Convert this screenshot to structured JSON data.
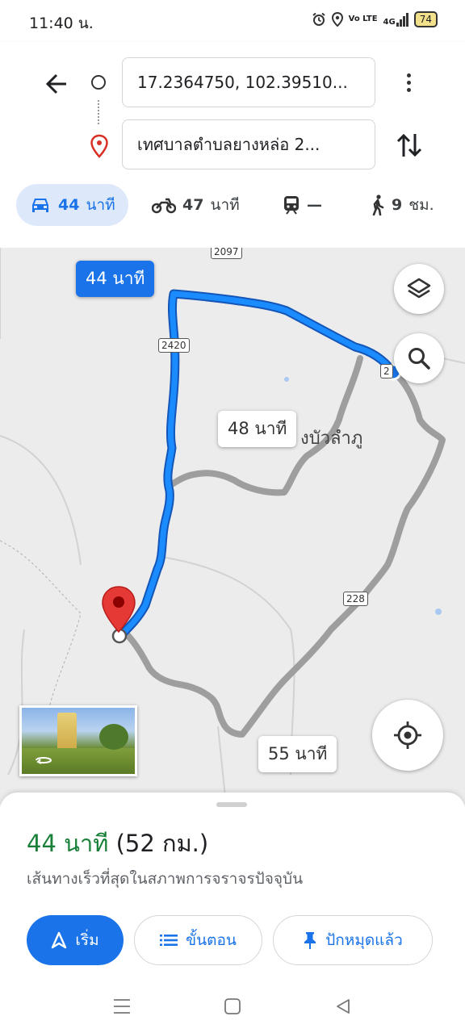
{
  "status": {
    "time": "11:40 น.",
    "volte": "Vo LTE",
    "network": "4G",
    "battery": "74"
  },
  "directions": {
    "origin": "17.2364750, 102.39510...",
    "destination": "เทศบาลตำบลยางหล่อ 2..."
  },
  "modes": [
    {
      "id": "drive",
      "time": "44",
      "unit": "นาที",
      "active": true
    },
    {
      "id": "motorcycle",
      "time": "47",
      "unit": "นาที",
      "active": false
    },
    {
      "id": "transit",
      "time": "—",
      "unit": "",
      "active": false
    },
    {
      "id": "walk",
      "time": "9",
      "unit": "ชม.",
      "active": false
    }
  ],
  "map": {
    "route_labels": {
      "primary": "44 นาที",
      "alt1": "48 นาที",
      "alt2": "55 นาที"
    },
    "road_numbers": {
      "r2097": "2097",
      "r2420": "2420",
      "r228": "228",
      "r2b": "2"
    },
    "place_label": "งบัวลำภู",
    "colors": {
      "route_primary": "#1a73e8",
      "route_alt": "#9e9e9e",
      "pin": "#e53935"
    }
  },
  "summary": {
    "time": "44 นาที",
    "distance": "(52 กม.)",
    "description": "เส้นทางเร็วที่สุดในสภาพการจราจรปัจจุบัน"
  },
  "actions": {
    "start": "เริ่ม",
    "steps": "ขั้นตอน",
    "pinned": "ปักหมุดแล้ว"
  }
}
